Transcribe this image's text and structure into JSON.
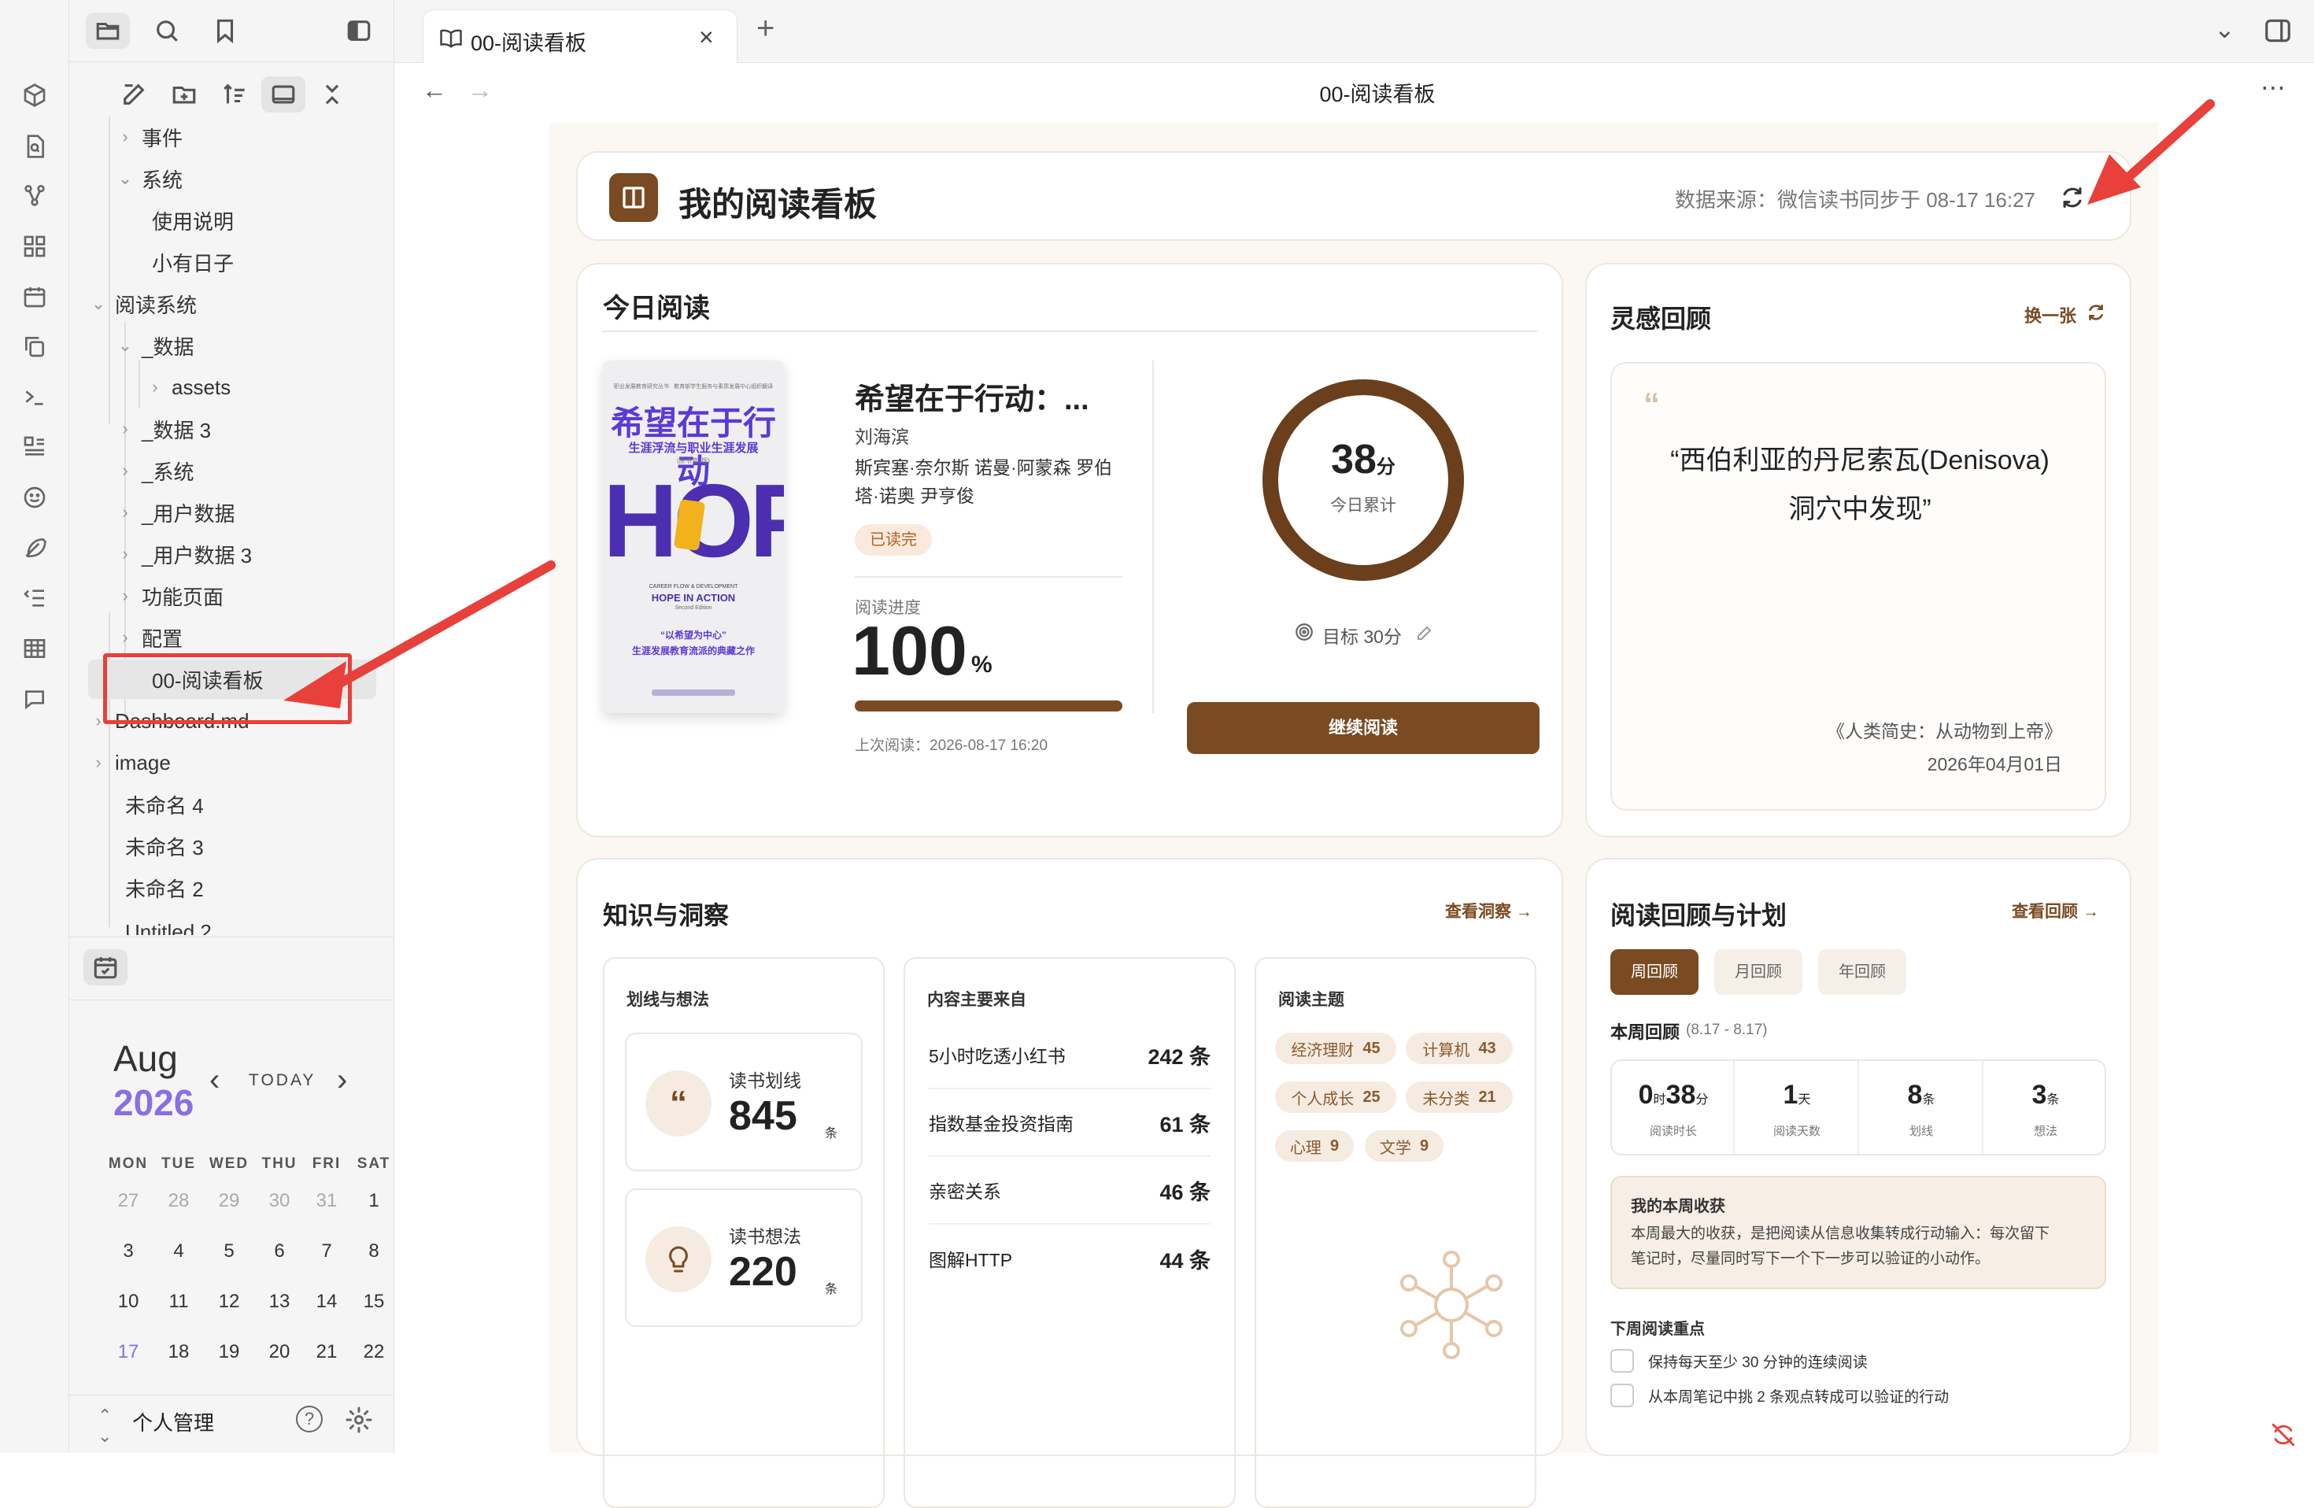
{
  "tab": {
    "title": "00-阅读看板"
  },
  "page": {
    "title": "00-阅读看板"
  },
  "sidebar": {
    "tree": [
      {
        "label": "事件",
        "expanded": false
      },
      {
        "label": "系统",
        "expanded": true
      },
      {
        "label": "使用说明"
      },
      {
        "label": "小有日子"
      },
      {
        "label": "阅读系统",
        "expanded": true
      },
      {
        "label": "_数据",
        "expanded": true
      },
      {
        "label": "assets",
        "expanded": false
      },
      {
        "label": "_数据 3",
        "expanded": false
      },
      {
        "label": "_系统",
        "expanded": false
      },
      {
        "label": "_用户数据",
        "expanded": false
      },
      {
        "label": "_用户数据 3",
        "expanded": false
      },
      {
        "label": "功能页面",
        "expanded": false
      },
      {
        "label": "配置",
        "expanded": false
      },
      {
        "label": "00-阅读看板",
        "active": true
      },
      {
        "label": "Dashboard.md",
        "expanded": false
      },
      {
        "label": "image",
        "expanded": false
      },
      {
        "label": "未命名 4"
      },
      {
        "label": "未命名 3"
      },
      {
        "label": "未命名 2"
      },
      {
        "label": "Untitled 2"
      }
    ],
    "calendar": {
      "month": "Aug",
      "year": "2026",
      "today_label": "TODAY",
      "weekdays": [
        "MON",
        "TUE",
        "WED",
        "THU",
        "FRI",
        "SAT"
      ],
      "rows": [
        [
          "27",
          "28",
          "29",
          "30",
          "31",
          "1"
        ],
        [
          "3",
          "4",
          "5",
          "6",
          "7",
          "8"
        ],
        [
          "10",
          "11",
          "12",
          "13",
          "14",
          "15"
        ],
        [
          "17",
          "18",
          "19",
          "20",
          "21",
          "22"
        ]
      ],
      "today": "17"
    },
    "vault": {
      "name": "个人管理"
    }
  },
  "dashboard": {
    "header": {
      "title": "我的阅读看板",
      "source_text": "数据来源：微信读书同步于 08-17 16:27"
    },
    "today": {
      "section_title": "今日阅读",
      "book": {
        "title": "希望在于行动：...",
        "author": "刘海滨",
        "translators": "斯宾塞·奈尔斯 诺曼·阿蒙森 罗伯塔·诺奥 尹亨俊",
        "status": "已读完",
        "cover": {
          "top_line": "职业发展教育研究丛书   ·   教育部学生服务与素质发展中心组织翻译",
          "title": "希望在于行动",
          "subtitle": "生涯浮流与职业生涯发展",
          "edition": "(原书第2版)",
          "big": "HOPE",
          "en1": "CAREER FLOW & DEVELOPMENT",
          "en2": "HOPE IN ACTION",
          "en3": "Second Edition",
          "quote1": "“以希望为中心”",
          "quote2": "生涯发展教育流派的典藏之作"
        }
      },
      "progress_label": "阅读进度",
      "progress_value": "100",
      "progress_unit": "%",
      "progress_fraction": 1.0,
      "last_read": "上次阅读：2026-08-17 16:20",
      "minutes": "38",
      "minutes_unit": "分",
      "minutes_label": "今日累计",
      "goal_text": "目标 30分",
      "continue_button": "继续阅读"
    },
    "inspiration": {
      "title": "灵感回顾",
      "swap_label": "换一张",
      "quote_line1": "“西伯利亚的丹尼索瓦(Denisova)",
      "quote_line2": "洞穴中发现”",
      "source": "《人类简史：从动物到上帝》",
      "date": "2026年04月01日"
    },
    "knowledge": {
      "title": "知识与洞察",
      "link": "查看洞察",
      "highlights": {
        "title": "划线与想法",
        "items": [
          {
            "label": "读书划线",
            "value": "845",
            "unit": "条"
          },
          {
            "label": "读书想法",
            "value": "220",
            "unit": "条"
          }
        ]
      },
      "sources": {
        "title": "内容主要来自",
        "rows": [
          {
            "name": "5小时吃透小红书",
            "count": "242 条"
          },
          {
            "name": "指数基金投资指南",
            "count": "61 条"
          },
          {
            "name": "亲密关系",
            "count": "46 条"
          },
          {
            "name": "图解HTTP",
            "count": "44 条"
          }
        ]
      },
      "topics": {
        "title": "阅读主题",
        "tags": [
          {
            "name": "经济理财",
            "count": "45"
          },
          {
            "name": "计算机",
            "count": "43"
          },
          {
            "name": "个人成长",
            "count": "25"
          },
          {
            "name": "未分类",
            "count": "21"
          },
          {
            "name": "心理",
            "count": "9"
          },
          {
            "name": "文学",
            "count": "9"
          }
        ]
      }
    },
    "review": {
      "title": "阅读回顾与计划",
      "link": "查看回顾",
      "tabs": [
        "周回顾",
        "月回顾",
        "年回顾"
      ],
      "week_title": "本周回顾",
      "week_range": "(8.17 - 8.17)",
      "stats": [
        {
          "value_a": "0",
          "unit_a": "时",
          "value_b": "38",
          "unit_b": "分",
          "label": "阅读时长"
        },
        {
          "value_a": "1",
          "unit_a": "天",
          "label": "阅读天数"
        },
        {
          "value_a": "8",
          "unit_a": "条",
          "label": "划线"
        },
        {
          "value_a": "3",
          "unit_a": "条",
          "label": "想法"
        }
      ],
      "harvest_title": "我的本周收获",
      "harvest_line1": "本周最大的收获，是把阅读从信息收集转成行动输入：每次留下",
      "harvest_line2": "笔记时，尽量同时写下一个下一步可以验证的小动作。",
      "plan_title": "下周阅读重点",
      "plan_items": [
        "保持每天至少 30 分钟的连续阅读",
        "从本周笔记中挑 2 条观点转成可以验证的行动"
      ]
    }
  },
  "colors": {
    "accent": "#7a4a22",
    "annotation": "#e8403a",
    "today": "#8a6ee6"
  }
}
